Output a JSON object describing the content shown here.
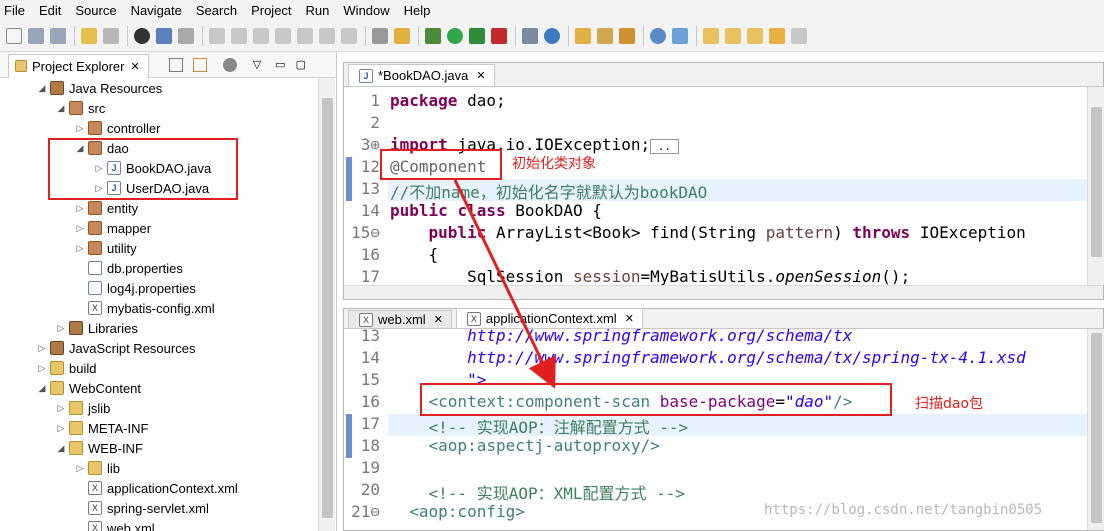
{
  "menu": [
    "File",
    "Edit",
    "Source",
    "Navigate",
    "Search",
    "Project",
    "Run",
    "Window",
    "Help"
  ],
  "explorer": {
    "tab_label": "Project Explorer",
    "items": [
      {
        "label": "Java Resources",
        "indent": 2,
        "arrow": "▲",
        "icon": "lib"
      },
      {
        "label": "src",
        "indent": 3,
        "arrow": "▲",
        "icon": "pkg"
      },
      {
        "label": "controller",
        "indent": 4,
        "arrow": "▷",
        "icon": "pkg"
      },
      {
        "label": "dao",
        "indent": 4,
        "arrow": "▲",
        "icon": "pkg"
      },
      {
        "label": "BookDAO.java",
        "indent": 5,
        "arrow": "▷",
        "icon": "java"
      },
      {
        "label": "UserDAO.java",
        "indent": 5,
        "arrow": "▷",
        "icon": "java"
      },
      {
        "label": "entity",
        "indent": 4,
        "arrow": "▷",
        "icon": "pkg"
      },
      {
        "label": "mapper",
        "indent": 4,
        "arrow": "▷",
        "icon": "pkg"
      },
      {
        "label": "utility",
        "indent": 4,
        "arrow": "▷",
        "icon": "pkg"
      },
      {
        "label": "db.properties",
        "indent": 4,
        "arrow": "",
        "icon": "file"
      },
      {
        "label": "log4j.properties",
        "indent": 4,
        "arrow": "",
        "icon": "file"
      },
      {
        "label": "mybatis-config.xml",
        "indent": 4,
        "arrow": "",
        "icon": "xml"
      },
      {
        "label": "Libraries",
        "indent": 3,
        "arrow": "▷",
        "icon": "lib"
      },
      {
        "label": "JavaScript Resources",
        "indent": 2,
        "arrow": "▷",
        "icon": "lib"
      },
      {
        "label": "build",
        "indent": 2,
        "arrow": "▷",
        "icon": "folder"
      },
      {
        "label": "WebContent",
        "indent": 2,
        "arrow": "▲",
        "icon": "folder"
      },
      {
        "label": "jslib",
        "indent": 3,
        "arrow": "▷",
        "icon": "folder"
      },
      {
        "label": "META-INF",
        "indent": 3,
        "arrow": "▷",
        "icon": "folder"
      },
      {
        "label": "WEB-INF",
        "indent": 3,
        "arrow": "▲",
        "icon": "folder"
      },
      {
        "label": "lib",
        "indent": 4,
        "arrow": "▷",
        "icon": "folder"
      },
      {
        "label": "applicationContext.xml",
        "indent": 4,
        "arrow": "",
        "icon": "xml"
      },
      {
        "label": "spring-servlet.xml",
        "indent": 4,
        "arrow": "",
        "icon": "xml"
      },
      {
        "label": "web.xml",
        "indent": 4,
        "arrow": "",
        "icon": "xml"
      }
    ]
  },
  "editor_top": {
    "tab_label": "*BookDAO.java",
    "lines": [
      {
        "n": "1",
        "html": "<span class='kw'>package</span> dao;"
      },
      {
        "n": "2",
        "html": ""
      },
      {
        "n": "3⊕",
        "html": "<span class='kw'>import</span> java.io.IOException;<span style='border:1px solid #999;font-size:11px;'>&nbsp;..&nbsp;</span>"
      },
      {
        "n": "12",
        "html": "<span class='ann'>@Component</span>"
      },
      {
        "n": "13",
        "html": "<span class='cm'>//不加name，初始化名字就默认为bookDAO</span>"
      },
      {
        "n": "14",
        "html": "<span class='kw'>public</span> <span class='kw'>class</span> BookDAO {"
      },
      {
        "n": "15⊖",
        "html": "    <span class='kw'>public</span> ArrayList&lt;Book&gt; find(String <span style='color:#6a3e3e'>pattern</span>) <span class='kw'>throws</span> IOException"
      },
      {
        "n": "16",
        "html": "    {"
      },
      {
        "n": "17",
        "html": "        SqlSession <span style='color:#6a3e3e'>session</span>=MyBatisUtils.<i>openSession</i>();"
      }
    ],
    "annotation": "初始化类对象"
  },
  "editor_bottom": {
    "tabs": [
      "web.xml",
      "applicationContext.xml"
    ],
    "lines": [
      {
        "n": "13",
        "html": "        <span class='str'>http://www.springframework.org/schema/tx</span>"
      },
      {
        "n": "14",
        "html": "        <span class='str'>http://www.springframework.org/schema/tx/spring-tx-4.1.xsd</span>"
      },
      {
        "n": "15",
        "html": "        <span class='str'>\"&gt;</span>"
      },
      {
        "n": "16",
        "html": "    <span class='tag'>&lt;context:component-scan</span> <span class='attr'>base-package</span>=<span class='str'>\"dao\"</span><span class='tag'>/&gt;</span>"
      },
      {
        "n": "17",
        "html": "    <span class='cm'>&lt;!-- 实现AOP：注解配置方式 --&gt;</span>"
      },
      {
        "n": "18",
        "html": "    <span class='tag'>&lt;aop:aspectj-autoproxy/&gt;</span>"
      },
      {
        "n": "19",
        "html": ""
      },
      {
        "n": "20",
        "html": "    <span class='cm'>&lt;!-- 实现AOP：XML配置方式 --&gt;</span>"
      },
      {
        "n": "21⊖",
        "html": "  <span class='tag'>&lt;aop:config&gt;</span>"
      }
    ],
    "annotation": "扫描dao包"
  },
  "watermark": "https://blog.csdn.net/tangbin0505"
}
